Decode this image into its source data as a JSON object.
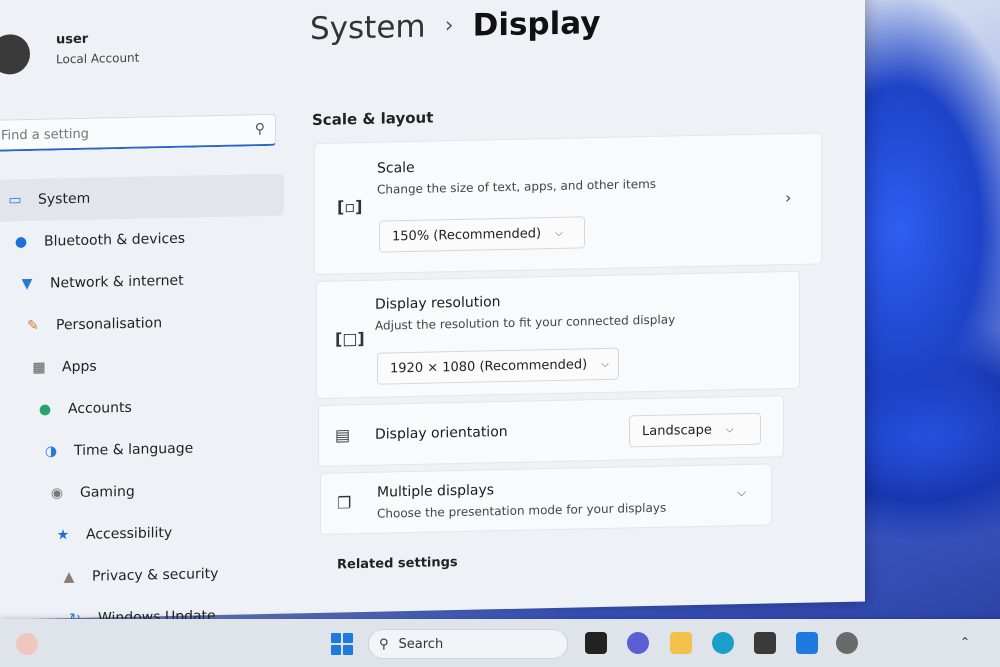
{
  "profile": {
    "name": "user",
    "account": "Local Account"
  },
  "search": {
    "placeholder": "Find a setting",
    "icon": "search-icon"
  },
  "sidebar": {
    "items": [
      {
        "label": "System",
        "icon": "monitor-icon",
        "color": "#2b79d6",
        "active": true
      },
      {
        "label": "Bluetooth & devices",
        "icon": "bluetooth-icon",
        "color": "#1f6fd8"
      },
      {
        "label": "Network & internet",
        "icon": "wifi-icon",
        "color": "#2b79d6"
      },
      {
        "label": "Personalisation",
        "icon": "brush-icon",
        "color": "#d07a2a"
      },
      {
        "label": "Apps",
        "icon": "apps-icon",
        "color": "#555555"
      },
      {
        "label": "Accounts",
        "icon": "person-icon",
        "color": "#2aa36a"
      },
      {
        "label": "Time & language",
        "icon": "globe-icon",
        "color": "#2b79d6"
      },
      {
        "label": "Gaming",
        "icon": "gamepad-icon",
        "color": "#777777"
      },
      {
        "label": "Accessibility",
        "icon": "accessibility-icon",
        "color": "#1f6fd8"
      },
      {
        "label": "Privacy & security",
        "icon": "shield-icon",
        "color": "#8a7a70"
      },
      {
        "label": "Windows Update",
        "icon": "update-icon",
        "color": "#2b79d6"
      }
    ]
  },
  "breadcrumb": {
    "parent": "System",
    "separator": "›",
    "current": "Display"
  },
  "section": {
    "title": "Scale & layout"
  },
  "scale": {
    "title": "Scale",
    "description": "Change the size of text, apps, and other items",
    "value": "150% (Recommended)",
    "icon": "scale-icon"
  },
  "resolution": {
    "title": "Display resolution",
    "description": "Adjust the resolution to fit your connected display",
    "value": "1920 × 1080 (Recommended)",
    "icon": "resolution-icon"
  },
  "orientation": {
    "title": "Display orientation",
    "value": "Landscape",
    "icon": "orientation-icon"
  },
  "multiple": {
    "title": "Multiple displays",
    "description": "Choose the presentation mode for your displays",
    "icon": "multiple-displays-icon"
  },
  "related": {
    "title": "Related settings"
  },
  "taskbar": {
    "search_label": "Search"
  }
}
